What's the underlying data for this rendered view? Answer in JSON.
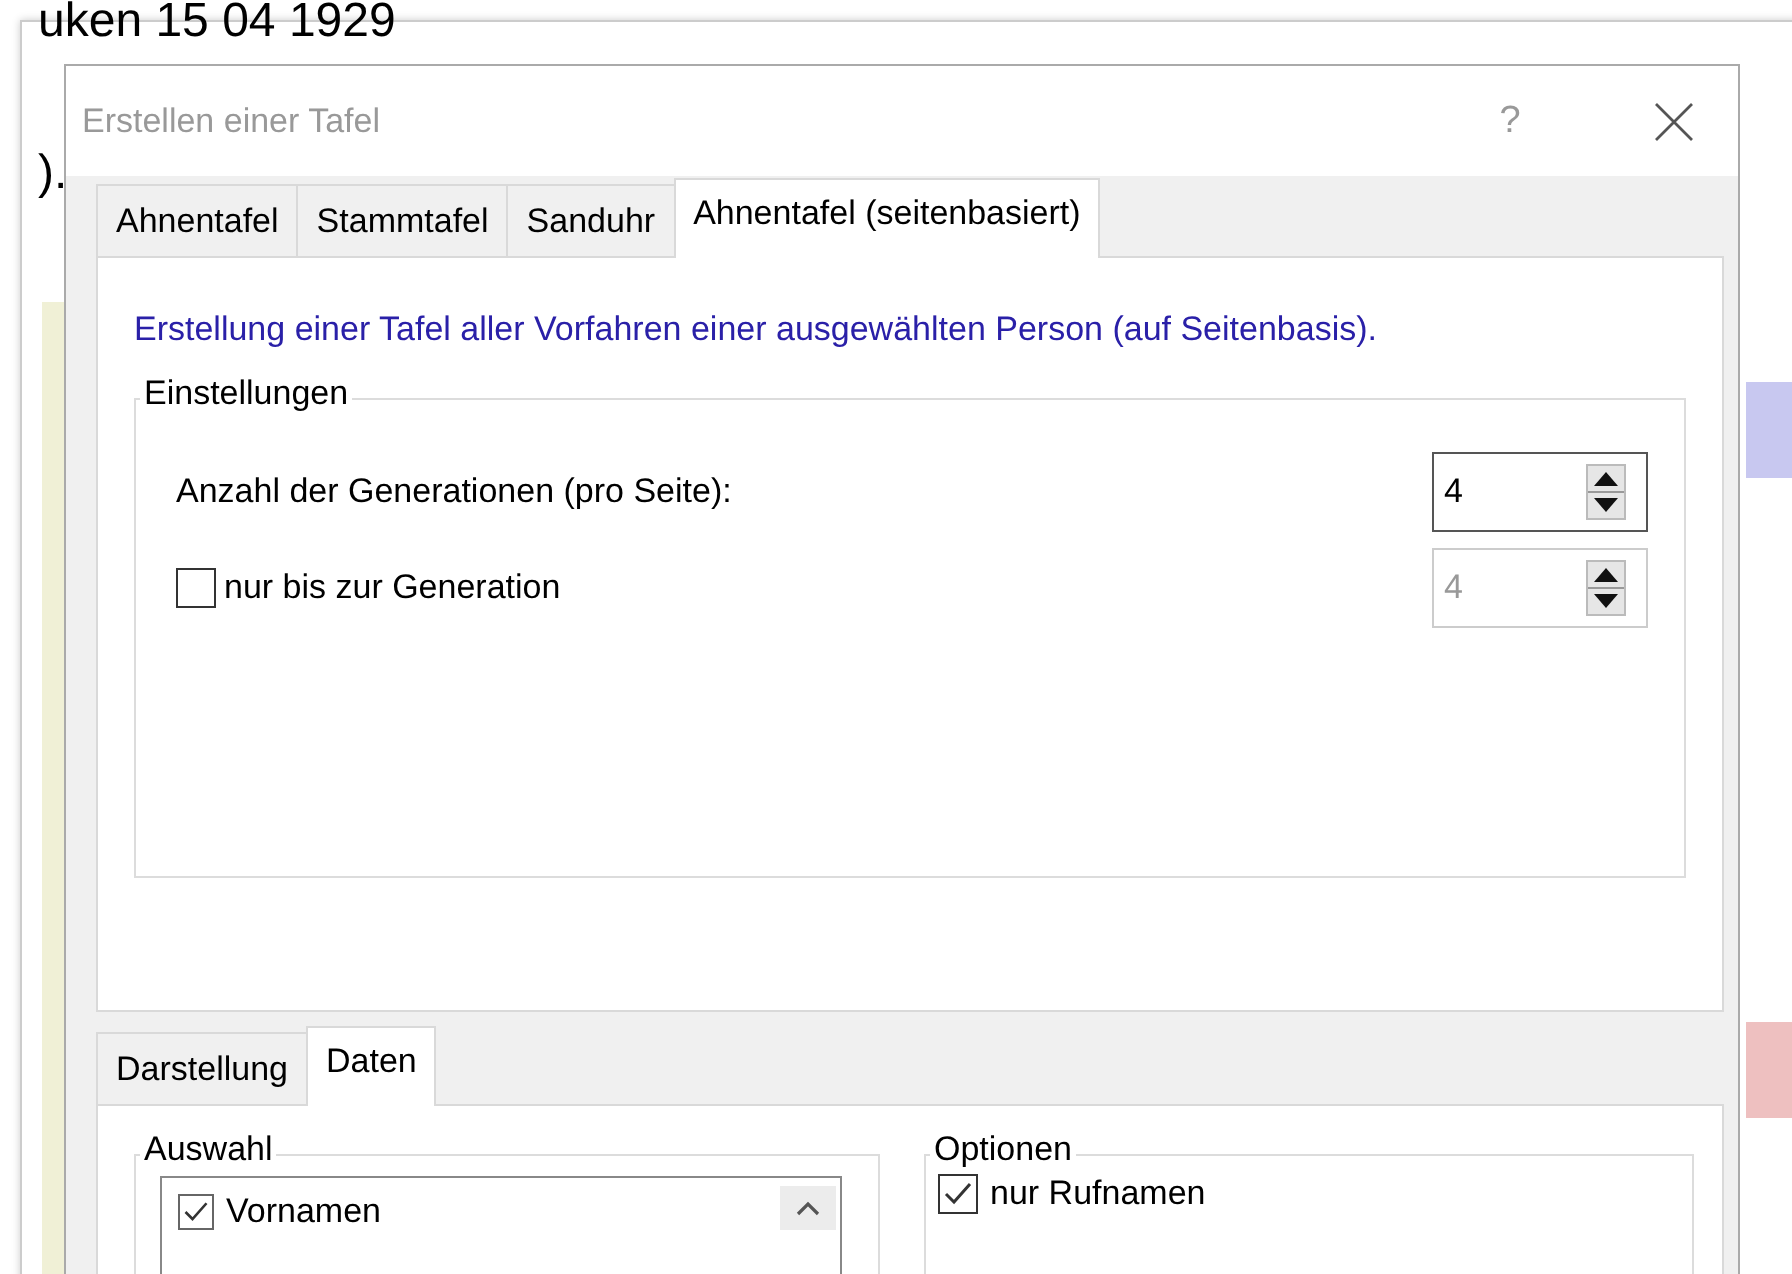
{
  "background": {
    "texts": [
      "uken 15 04 1929",
      ")."
    ]
  },
  "dialog": {
    "title": "Erstellen einer Tafel",
    "help": "?",
    "tabs": [
      {
        "label": "Ahnentafel",
        "selected": false
      },
      {
        "label": "Stammtafel",
        "selected": false
      },
      {
        "label": "Sanduhr",
        "selected": false
      },
      {
        "label": "Ahnentafel (seitenbasiert)",
        "selected": true
      }
    ],
    "description": "Erstellung einer Tafel aller Vorfahren einer ausgewählten Person (auf Seitenbasis).",
    "settings": {
      "title": "Einstellungen",
      "rows": [
        {
          "kind": "label",
          "label": "Anzahl der Generationen (pro Seite):",
          "value": "4",
          "disabled": false
        },
        {
          "kind": "checkbox",
          "label": "nur bis zur Generation",
          "checked": false,
          "value": "4",
          "disabled": true
        }
      ]
    },
    "bottom_tabs": [
      {
        "label": "Darstellung",
        "selected": false
      },
      {
        "label": "Daten",
        "selected": true
      }
    ],
    "auswahl": {
      "title": "Auswahl",
      "items": [
        {
          "label": "Vornamen",
          "checked": true
        }
      ]
    },
    "optionen": {
      "title": "Optionen",
      "items": [
        {
          "label": "nur Rufnamen",
          "checked": true
        }
      ]
    }
  }
}
